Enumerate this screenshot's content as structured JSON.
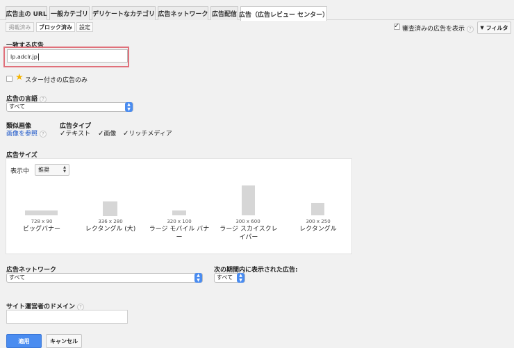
{
  "tabs": [
    {
      "label": "広告主の URL"
    },
    {
      "label": "一般カテゴリ"
    },
    {
      "label": "デリケートなカテゴリ"
    },
    {
      "label": "広告ネットワーク"
    },
    {
      "label": "広告配信"
    },
    {
      "label": "広告（広告レビュー センター）"
    }
  ],
  "subtabs": [
    {
      "label": "掲載済み"
    },
    {
      "label": "ブロック済み"
    },
    {
      "label": "設定"
    }
  ],
  "toolbar": {
    "show_reviewed_label": "審査済みの広告を表示",
    "filter_label": "フィルタ"
  },
  "match": {
    "label": "一致する広告",
    "value": "lp.adclr.jp"
  },
  "starred_label": "スター付きの広告のみ",
  "language": {
    "label": "広告の言語",
    "value": "すべて"
  },
  "similar": {
    "label": "類似画像",
    "link": "画像を参照"
  },
  "ad_type": {
    "label": "広告タイプ",
    "options": [
      {
        "label": "テキスト",
        "checked": true
      },
      {
        "label": "画像",
        "checked": true
      },
      {
        "label": "リッチメディア",
        "checked": true
      }
    ]
  },
  "ad_size": {
    "label": "広告サイズ",
    "show_label": "表示中",
    "show_value": "推奨",
    "sizes": [
      {
        "dim": "728 x 90",
        "name": "ビッグバナー"
      },
      {
        "dim": "336 x 280",
        "name": "レクタングル (大)"
      },
      {
        "dim": "320 x 100",
        "name": "ラージ モバイル バナー"
      },
      {
        "dim": "300 x 600",
        "name": "ラージ スカイスクレイパー"
      },
      {
        "dim": "300 x 250",
        "name": "レクタングル"
      }
    ]
  },
  "network": {
    "label": "広告ネットワーク",
    "value": "すべて"
  },
  "period": {
    "label": "次の期間内に表示された広告:",
    "value": "すべて"
  },
  "domain": {
    "label": "サイト運営者のドメイン",
    "value": ""
  },
  "buttons": {
    "apply": "適用",
    "cancel": "キャンセル"
  },
  "colors": {
    "accent": "#4a8cf0",
    "highlight": "#e0707a",
    "link": "#1a55c8",
    "star": "#f5b400"
  }
}
